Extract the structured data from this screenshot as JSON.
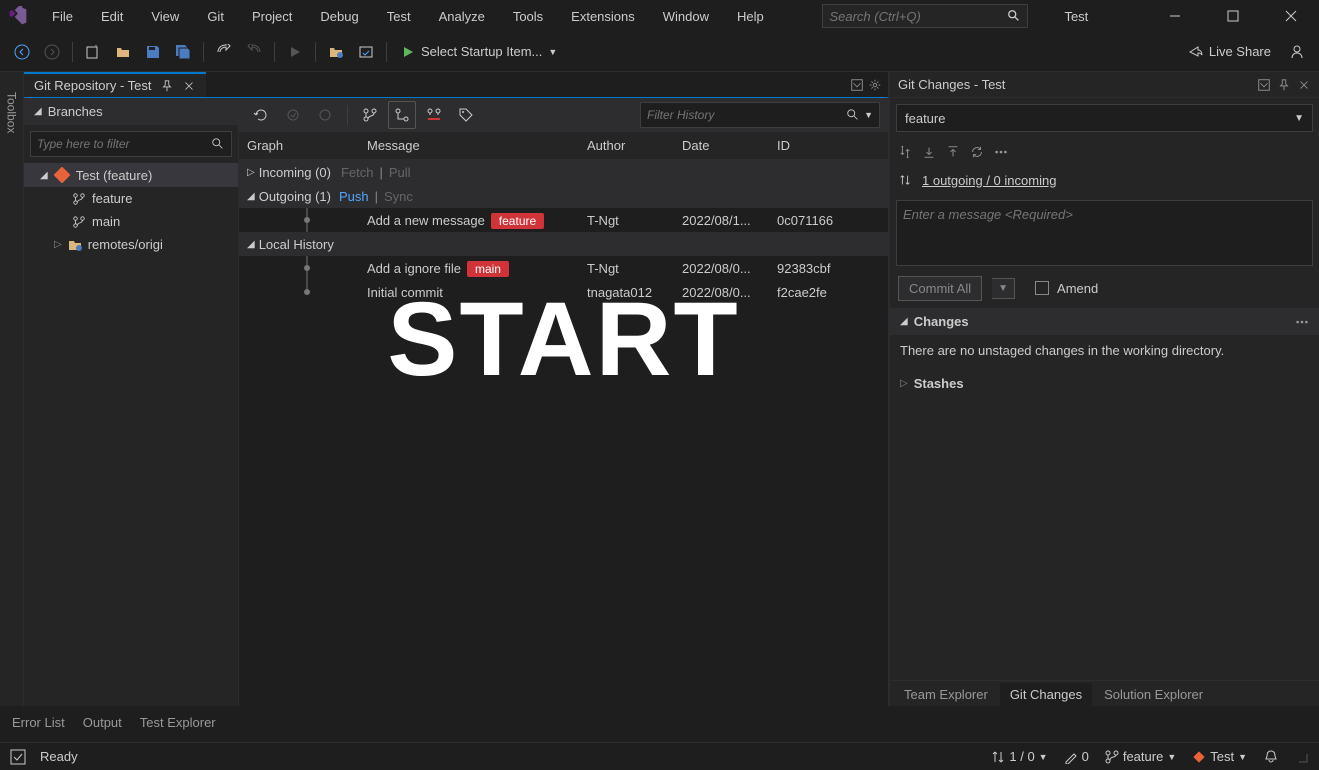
{
  "menu": {
    "file": "File",
    "edit": "Edit",
    "view": "View",
    "git": "Git",
    "project": "Project",
    "debug": "Debug",
    "test": "Test",
    "analyze": "Analyze",
    "tools": "Tools",
    "extensions": "Extensions",
    "window": "Window",
    "help": "Help"
  },
  "search": {
    "placeholder": "Search (Ctrl+Q)"
  },
  "projectLabel": "Test",
  "toolbar": {
    "startup": "Select Startup Item...",
    "liveShare": "Live Share"
  },
  "gitRepo": {
    "tabTitle": "Git Repository - Test"
  },
  "branches": {
    "header": "Branches",
    "filterPlaceholder": "Type here to filter",
    "root": "Test (feature)",
    "items": [
      "feature",
      "main",
      "remotes/origi"
    ]
  },
  "history": {
    "filterPlaceholder": "Filter History",
    "cols": {
      "graph": "Graph",
      "message": "Message",
      "author": "Author",
      "date": "Date",
      "id": "ID"
    },
    "incoming": {
      "label": "Incoming (0)",
      "fetch": "Fetch",
      "pull": "Pull"
    },
    "outgoing": {
      "label": "Outgoing (1)",
      "push": "Push",
      "sync": "Sync"
    },
    "commits": [
      {
        "msg": "Add a new message",
        "badge": "feature",
        "author": "T-Ngt",
        "date": "2022/08/1...",
        "id": "0c071166"
      }
    ],
    "localHeader": "Local History",
    "local": [
      {
        "msg": "Add a ignore file",
        "badge": "main",
        "author": "T-Ngt",
        "date": "2022/08/0...",
        "id": "92383cbf"
      },
      {
        "msg": "Initial commit",
        "badge": "",
        "author": "tnagata012",
        "date": "2022/08/0...",
        "id": "f2cae2fe"
      }
    ]
  },
  "overlay": "START",
  "gitChanges": {
    "title": "Git Changes - Test",
    "branch": "feature",
    "syncText": "1 outgoing / 0 incoming",
    "msgPlaceholder": "Enter a message <Required>",
    "commitBtn": "Commit All",
    "amend": "Amend",
    "changesHeader": "Changes",
    "noChanges": "There are no unstaged changes in the working directory.",
    "stashes": "Stashes"
  },
  "bottomTabs": {
    "team": "Team Explorer",
    "git": "Git Changes",
    "solution": "Solution Explorer"
  },
  "outputTabs": {
    "error": "Error List",
    "output": "Output",
    "testExp": "Test Explorer"
  },
  "status": {
    "ready": "Ready",
    "sync": "1 / 0",
    "pencil": "0",
    "branch": "feature",
    "repo": "Test"
  }
}
